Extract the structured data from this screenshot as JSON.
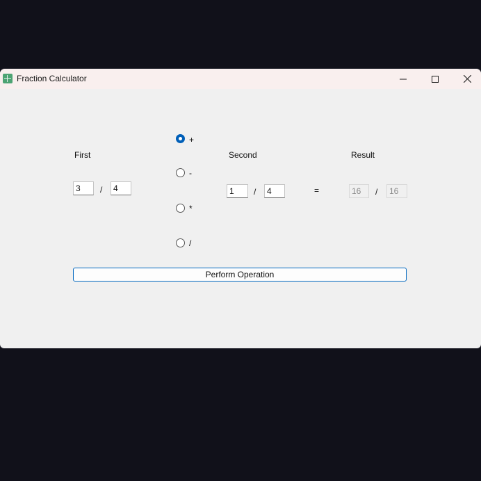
{
  "window": {
    "title": "Fraction Calculator"
  },
  "labels": {
    "first": "First",
    "second": "Second",
    "result": "Result",
    "equals": "=",
    "slash": "/"
  },
  "first": {
    "numerator": "3",
    "denominator": "4"
  },
  "second": {
    "numerator": "1",
    "denominator": "4"
  },
  "result": {
    "numerator": "16",
    "denominator": "16"
  },
  "operations": [
    {
      "label": "+",
      "checked": true
    },
    {
      "label": "-",
      "checked": false
    },
    {
      "label": "*",
      "checked": false
    },
    {
      "label": "/",
      "checked": false
    }
  ],
  "button": {
    "perform_label": "Perform Operation"
  },
  "colors": {
    "accent": "#005fb8",
    "titlebar": "#f9efee",
    "window_bg": "#f0f0f0",
    "desktop_bg": "#11111a"
  },
  "icons": {
    "app": "calculator-icon",
    "minimize": "minimize-icon",
    "maximize": "maximize-icon",
    "close": "close-icon"
  }
}
